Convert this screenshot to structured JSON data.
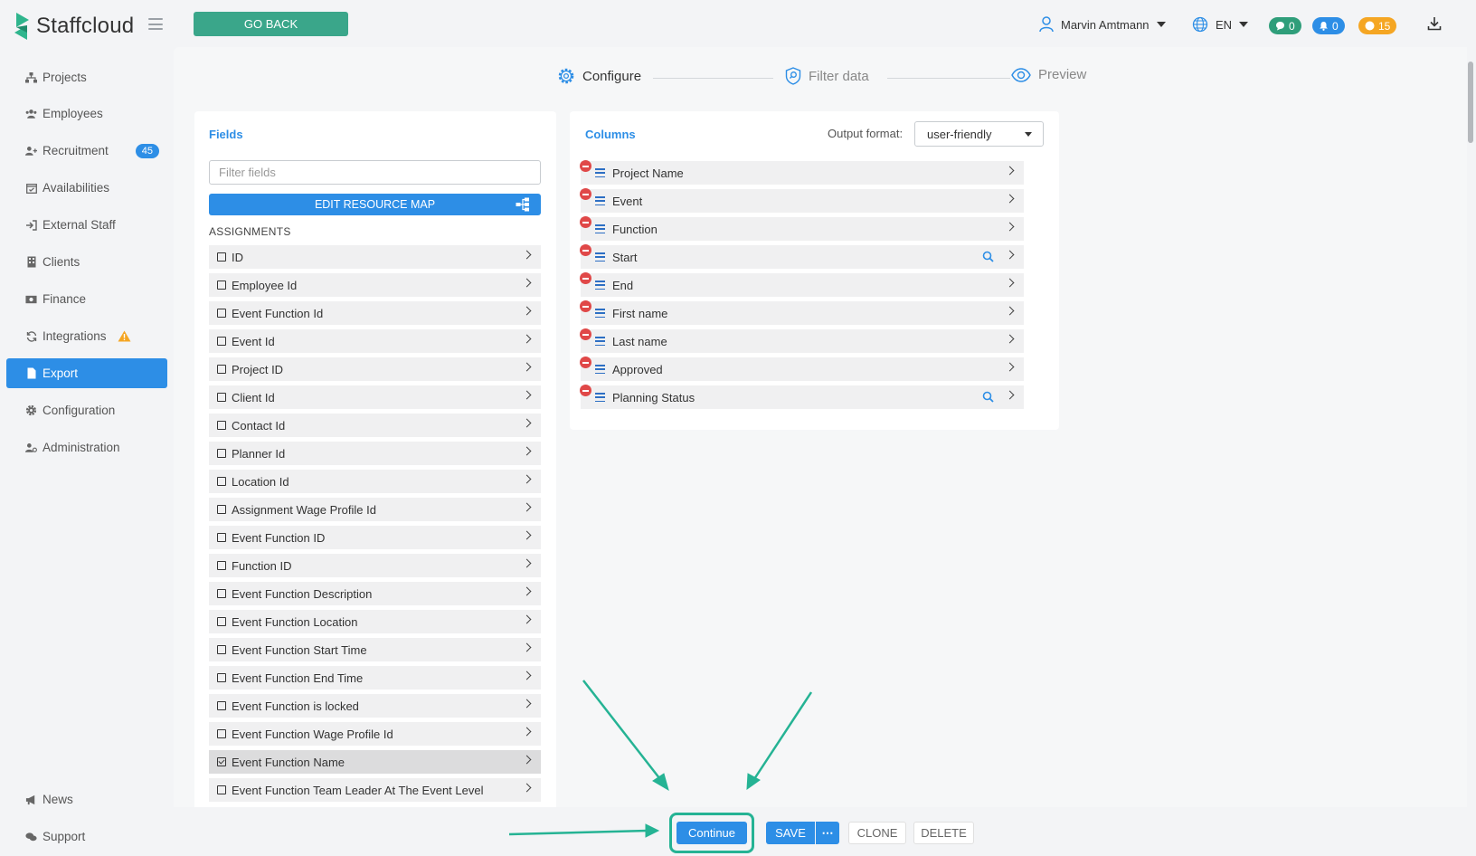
{
  "app": {
    "brand": "Staffcloud"
  },
  "header": {
    "go_back": "GO BACK",
    "user_name": "Marvin Amtmann",
    "language": "EN",
    "badges": [
      {
        "name": "messages",
        "count": "0",
        "color": "#2f9e7a"
      },
      {
        "name": "notifications",
        "count": "0",
        "color": "#2d8ee6"
      },
      {
        "name": "alerts",
        "count": "15",
        "color": "#f5a623"
      }
    ]
  },
  "sidebar": {
    "items": [
      {
        "label": "Projects",
        "icon": "sitemap-icon"
      },
      {
        "label": "Employees",
        "icon": "users-icon"
      },
      {
        "label": "Recruitment",
        "icon": "user-plus-icon",
        "badge": "45"
      },
      {
        "label": "Availabilities",
        "icon": "calendar-check-icon"
      },
      {
        "label": "External Staff",
        "icon": "sign-in-icon"
      },
      {
        "label": "Clients",
        "icon": "building-icon"
      },
      {
        "label": "Finance",
        "icon": "money-icon"
      },
      {
        "label": "Integrations",
        "icon": "sync-icon",
        "warning": true
      },
      {
        "label": "Export",
        "icon": "file-icon",
        "active": true
      },
      {
        "label": "Configuration",
        "icon": "gear-icon"
      },
      {
        "label": "Administration",
        "icon": "user-cog-icon"
      }
    ],
    "bottom": [
      {
        "label": "News",
        "icon": "megaphone-icon"
      },
      {
        "label": "Support",
        "icon": "comments-icon"
      }
    ]
  },
  "steps": [
    {
      "label": "Configure",
      "active": true,
      "icon": "gear-icon"
    },
    {
      "label": "Filter data",
      "active": false,
      "icon": "shield-search-icon"
    },
    {
      "label": "Preview",
      "active": false,
      "icon": "eye-icon"
    }
  ],
  "fields_panel": {
    "title": "Fields",
    "filter_placeholder": "Filter fields",
    "edit_map_label": "EDIT RESOURCE MAP",
    "section": "ASSIGNMENTS",
    "items": [
      {
        "label": "ID",
        "checked": false
      },
      {
        "label": "Employee Id",
        "checked": false
      },
      {
        "label": "Event Function Id",
        "checked": false
      },
      {
        "label": "Event Id",
        "checked": false
      },
      {
        "label": "Project ID",
        "checked": false
      },
      {
        "label": "Client Id",
        "checked": false
      },
      {
        "label": "Contact Id",
        "checked": false
      },
      {
        "label": "Planner Id",
        "checked": false
      },
      {
        "label": "Location Id",
        "checked": false
      },
      {
        "label": "Assignment Wage Profile Id",
        "checked": false
      },
      {
        "label": "Event Function ID",
        "checked": false
      },
      {
        "label": "Function ID",
        "checked": false
      },
      {
        "label": "Event Function Description",
        "checked": false
      },
      {
        "label": "Event Function Location",
        "checked": false
      },
      {
        "label": "Event Function Start Time",
        "checked": false
      },
      {
        "label": "Event Function End Time",
        "checked": false
      },
      {
        "label": "Event Function is locked",
        "checked": false
      },
      {
        "label": "Event Function Wage Profile Id",
        "checked": false
      },
      {
        "label": "Event Function Name",
        "checked": true
      },
      {
        "label": "Event Function Team Leader At The Event Level",
        "checked": false
      }
    ]
  },
  "columns_panel": {
    "title": "Columns",
    "output_format_label": "Output format:",
    "output_format_value": "user-friendly",
    "items": [
      {
        "label": "Project Name",
        "search": false
      },
      {
        "label": "Event",
        "search": false
      },
      {
        "label": "Function",
        "search": false
      },
      {
        "label": "Start",
        "search": true
      },
      {
        "label": "End",
        "search": false
      },
      {
        "label": "First name",
        "search": false
      },
      {
        "label": "Last name",
        "search": false
      },
      {
        "label": "Approved",
        "search": false
      },
      {
        "label": "Planning Status",
        "search": true
      }
    ]
  },
  "footer": {
    "continue": "Continue",
    "save": "SAVE",
    "more": "⋯",
    "clone": "CLONE",
    "delete": "DELETE"
  },
  "colors": {
    "accent": "#2d8ee6",
    "brand_green": "#3aa68a",
    "annotation": "#25b394",
    "danger": "#e04848"
  }
}
